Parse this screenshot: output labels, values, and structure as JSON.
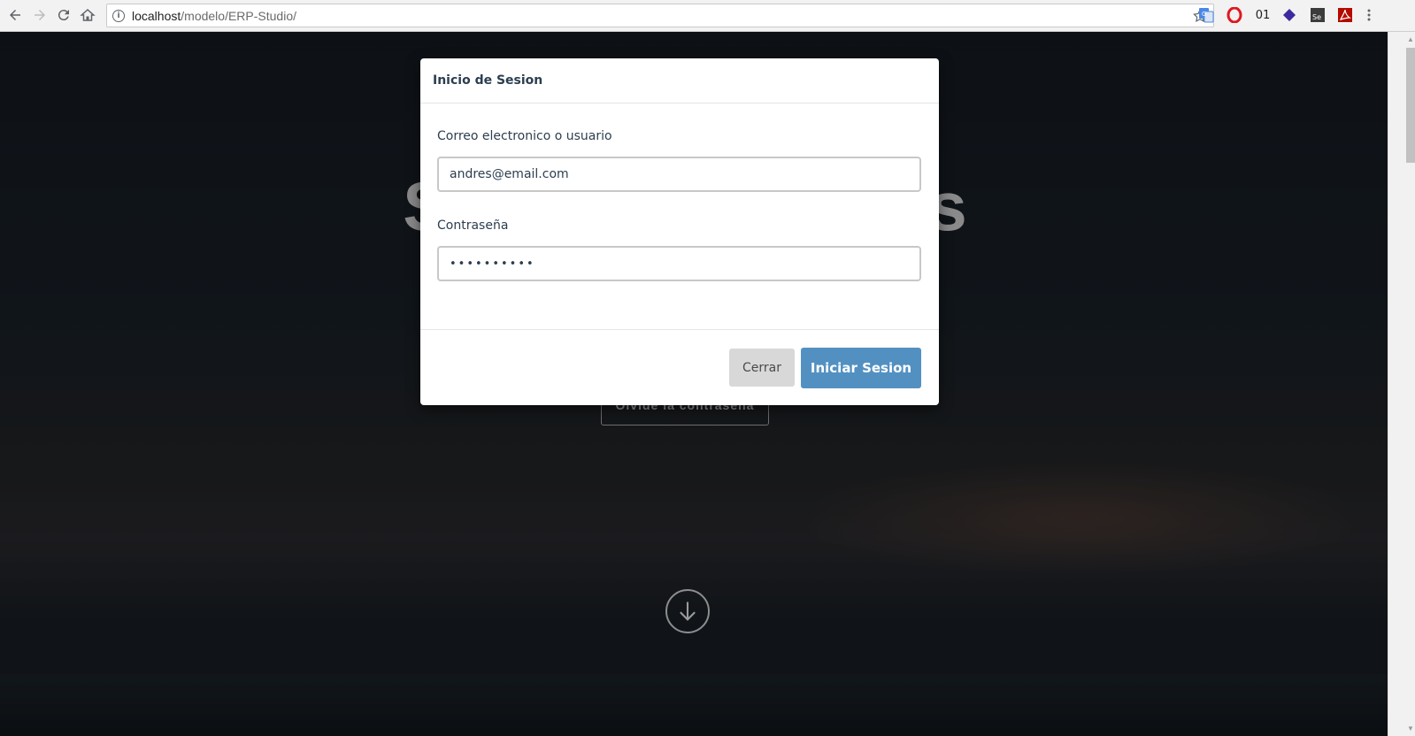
{
  "browser": {
    "url_host": "localhost",
    "url_path": "/modelo/ERP-Studio/",
    "extension_counter": "01"
  },
  "page": {
    "hero_title_fragment_left": "S",
    "hero_title_fragment_right": "s",
    "forgot_password_label": "Olvide la contraseña"
  },
  "modal": {
    "title": "Inicio de Sesion",
    "email_label": "Correo electronico o usuario",
    "email_value": "andres@email.com",
    "password_label": "Contraseña",
    "password_value": "••••••••••",
    "close_label": "Cerrar",
    "submit_label": "Iniciar Sesion"
  },
  "colors": {
    "primary_button": "#5390c2",
    "close_button": "#d8d8d8",
    "text": "#2c3e50"
  }
}
